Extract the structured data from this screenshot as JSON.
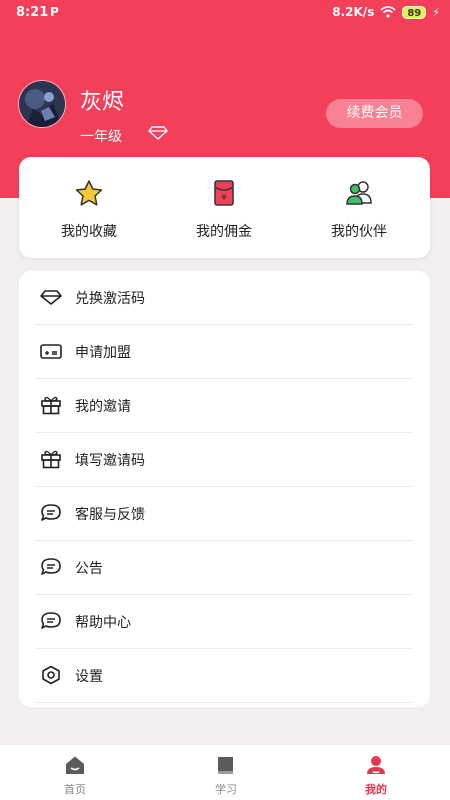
{
  "status_bar": {
    "time": "8:21",
    "app_icon": "P",
    "network": "8.2K/s",
    "battery": "89",
    "charging_icon": "⚡"
  },
  "profile": {
    "name": "灰烬",
    "grade": "一年级",
    "renew_label": "续费会员"
  },
  "quick_actions": [
    {
      "label": "我的收藏",
      "icon": "star-icon"
    },
    {
      "label": "我的佣金",
      "icon": "red-envelope-icon"
    },
    {
      "label": "我的伙伴",
      "icon": "partners-icon"
    }
  ],
  "menu": [
    {
      "label": "兑换激活码",
      "icon": "diamond-icon"
    },
    {
      "label": "申请加盟",
      "icon": "card-icon"
    },
    {
      "label": "我的邀请",
      "icon": "gift-icon"
    },
    {
      "label": "填写邀请码",
      "icon": "gift-icon"
    },
    {
      "label": "客服与反馈",
      "icon": "chat-icon"
    },
    {
      "label": "公告",
      "icon": "chat-icon"
    },
    {
      "label": "帮助中心",
      "icon": "chat-icon"
    },
    {
      "label": "设置",
      "icon": "settings-icon"
    }
  ],
  "tabs": [
    {
      "label": "首页",
      "icon": "home-icon",
      "active": false
    },
    {
      "label": "学习",
      "icon": "book-icon",
      "active": false
    },
    {
      "label": "我的",
      "icon": "user-icon",
      "active": true
    }
  ],
  "colors": {
    "brand": "#f43f5a",
    "active_tab": "#e8384f",
    "background": "#f3eff0"
  }
}
